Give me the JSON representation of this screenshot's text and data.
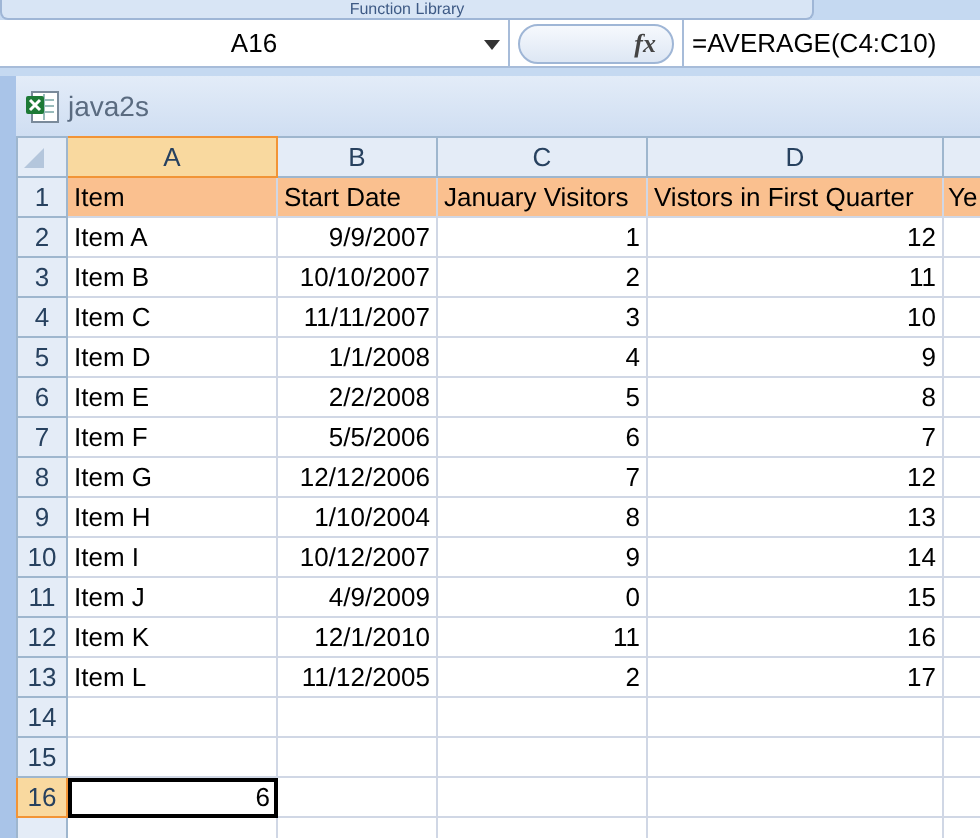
{
  "ribbon": {
    "group_label": "Function Library"
  },
  "formula_bar": {
    "name_box": "A16",
    "function_button": "fx",
    "formula": "=AVERAGE(C4:C10)"
  },
  "workbook": {
    "title": "java2s",
    "columns": [
      {
        "label": "A",
        "selected": true
      },
      {
        "label": "B",
        "selected": false
      },
      {
        "label": "C",
        "selected": false
      },
      {
        "label": "D",
        "selected": false
      }
    ],
    "rows": [
      {
        "number": "1",
        "selected": false,
        "kind": "header",
        "cells": [
          "Item",
          "Start Date",
          "January Visitors",
          "Vistors in First Quarter",
          "Ye"
        ]
      },
      {
        "number": "2",
        "selected": false,
        "kind": "data",
        "cells": [
          "Item A",
          "9/9/2007",
          "1",
          "12"
        ]
      },
      {
        "number": "3",
        "selected": false,
        "kind": "data",
        "cells": [
          "Item B",
          "10/10/2007",
          "2",
          "11"
        ]
      },
      {
        "number": "4",
        "selected": false,
        "kind": "data",
        "cells": [
          "Item C",
          "11/11/2007",
          "3",
          "10"
        ]
      },
      {
        "number": "5",
        "selected": false,
        "kind": "data",
        "cells": [
          "Item D",
          "1/1/2008",
          "4",
          "9"
        ]
      },
      {
        "number": "6",
        "selected": false,
        "kind": "data",
        "cells": [
          "Item E",
          "2/2/2008",
          "5",
          "8"
        ]
      },
      {
        "number": "7",
        "selected": false,
        "kind": "data",
        "cells": [
          "Item F",
          "5/5/2006",
          "6",
          "7"
        ]
      },
      {
        "number": "8",
        "selected": false,
        "kind": "data",
        "cells": [
          "Item G",
          "12/12/2006",
          "7",
          "12"
        ]
      },
      {
        "number": "9",
        "selected": false,
        "kind": "data",
        "cells": [
          "Item H",
          "1/10/2004",
          "8",
          "13"
        ]
      },
      {
        "number": "10",
        "selected": false,
        "kind": "data",
        "cells": [
          "Item I",
          "10/12/2007",
          "9",
          "14"
        ]
      },
      {
        "number": "11",
        "selected": false,
        "kind": "data",
        "cells": [
          "Item J",
          "4/9/2009",
          "0",
          "15"
        ]
      },
      {
        "number": "12",
        "selected": false,
        "kind": "data",
        "cells": [
          "Item K",
          "12/1/2010",
          "11",
          "16"
        ]
      },
      {
        "number": "13",
        "selected": false,
        "kind": "data",
        "cells": [
          "Item L",
          "11/12/2005",
          "2",
          "17"
        ]
      },
      {
        "number": "14",
        "selected": false,
        "kind": "data",
        "cells": []
      },
      {
        "number": "15",
        "selected": false,
        "kind": "data",
        "cells": []
      },
      {
        "number": "16",
        "selected": true,
        "kind": "result",
        "cells": [
          "6"
        ]
      }
    ]
  }
}
